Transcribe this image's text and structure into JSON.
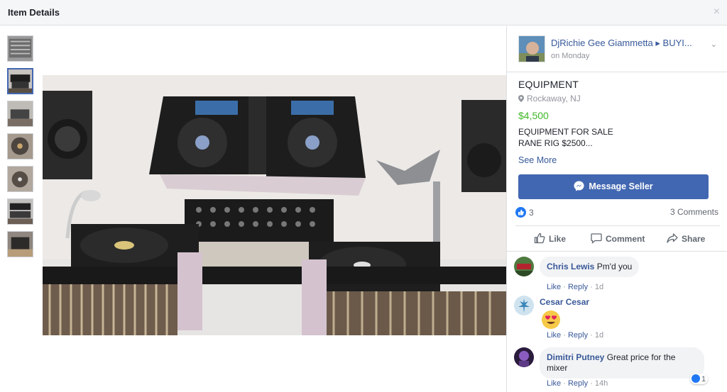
{
  "header": {
    "title": "Item Details",
    "close_glyph": "×"
  },
  "thumbnails": [
    {
      "icon": "photo-thumbnail",
      "active": false
    },
    {
      "icon": "photo-thumbnail",
      "active": true
    },
    {
      "icon": "photo-thumbnail",
      "active": false
    },
    {
      "icon": "photo-thumbnail",
      "active": false
    },
    {
      "icon": "photo-thumbnail",
      "active": false
    },
    {
      "icon": "photo-thumbnail",
      "active": false
    },
    {
      "icon": "photo-thumbnail",
      "active": false
    }
  ],
  "seller": {
    "name": "DjRichie Gee Giammetta ▸ BUYI...",
    "time": "on Monday",
    "chevron": "⌄"
  },
  "item": {
    "title": "EQUIPMENT",
    "location": "Rockaway, NJ",
    "price": "$4,500",
    "description": "EQUIPMENT FOR SALE\nRANE RIG $2500...",
    "see_more": "See More"
  },
  "message_button": {
    "label": "Message Seller"
  },
  "reactions": {
    "count": "3",
    "comments_count": "3 Comments"
  },
  "actions": {
    "like": "Like",
    "comment": "Comment",
    "share": "Share"
  },
  "comments": [
    {
      "author": "Chris Lewis",
      "text": "Pm'd you",
      "like": "Like",
      "reply": "Reply",
      "sep": "·",
      "time": "1d"
    },
    {
      "author": "Cesar Cesar",
      "text": "😍",
      "like": "Like",
      "reply": "Reply",
      "sep": "·",
      "time": "1d"
    },
    {
      "author": "Dimitri Putney",
      "text": "Great price for the mixer",
      "like": "Like",
      "reply": "Reply",
      "sep": "·",
      "time": "14h",
      "reaction_count": "1"
    }
  ],
  "colors": {
    "accent": "#4267b2",
    "link": "#365899",
    "price": "#42b72a",
    "header_bg": "#f5f6f7"
  }
}
